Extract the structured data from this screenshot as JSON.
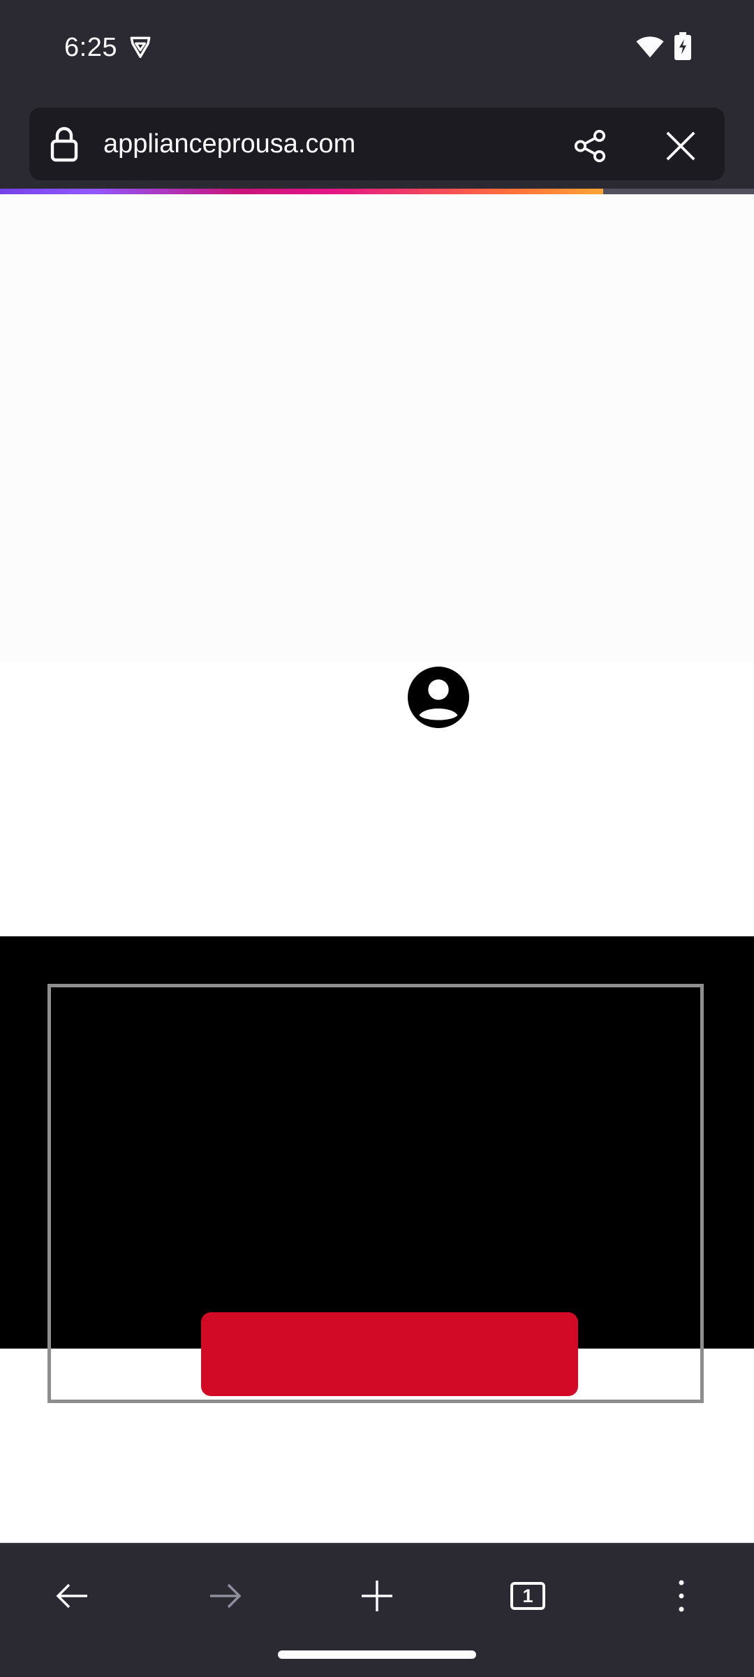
{
  "status_bar": {
    "time": "6:25",
    "app_icon": "brave-lion-icon",
    "wifi_icon": "wifi-icon",
    "battery_icon": "battery-charging-icon"
  },
  "toolbar": {
    "url": "applianceprousa.com",
    "lock_icon": "lock-icon",
    "share_icon": "share-icon",
    "close_icon": "close-icon"
  },
  "progress": {
    "fraction": 0.8
  },
  "web_content": {
    "account_icon": "account-circle-icon"
  },
  "bottom_nav": {
    "back_icon": "arrow-back-icon",
    "forward_icon": "arrow-forward-icon",
    "new_tab_icon": "plus-icon",
    "tab_count": "1",
    "menu_icon": "more-vertical-icon"
  },
  "colors": {
    "chrome_bg": "#2b2a33",
    "url_field_bg": "#1c1b22",
    "text": "#fbfbfe",
    "disabled": "#8f8f9d",
    "red_button": "#d20a26"
  }
}
